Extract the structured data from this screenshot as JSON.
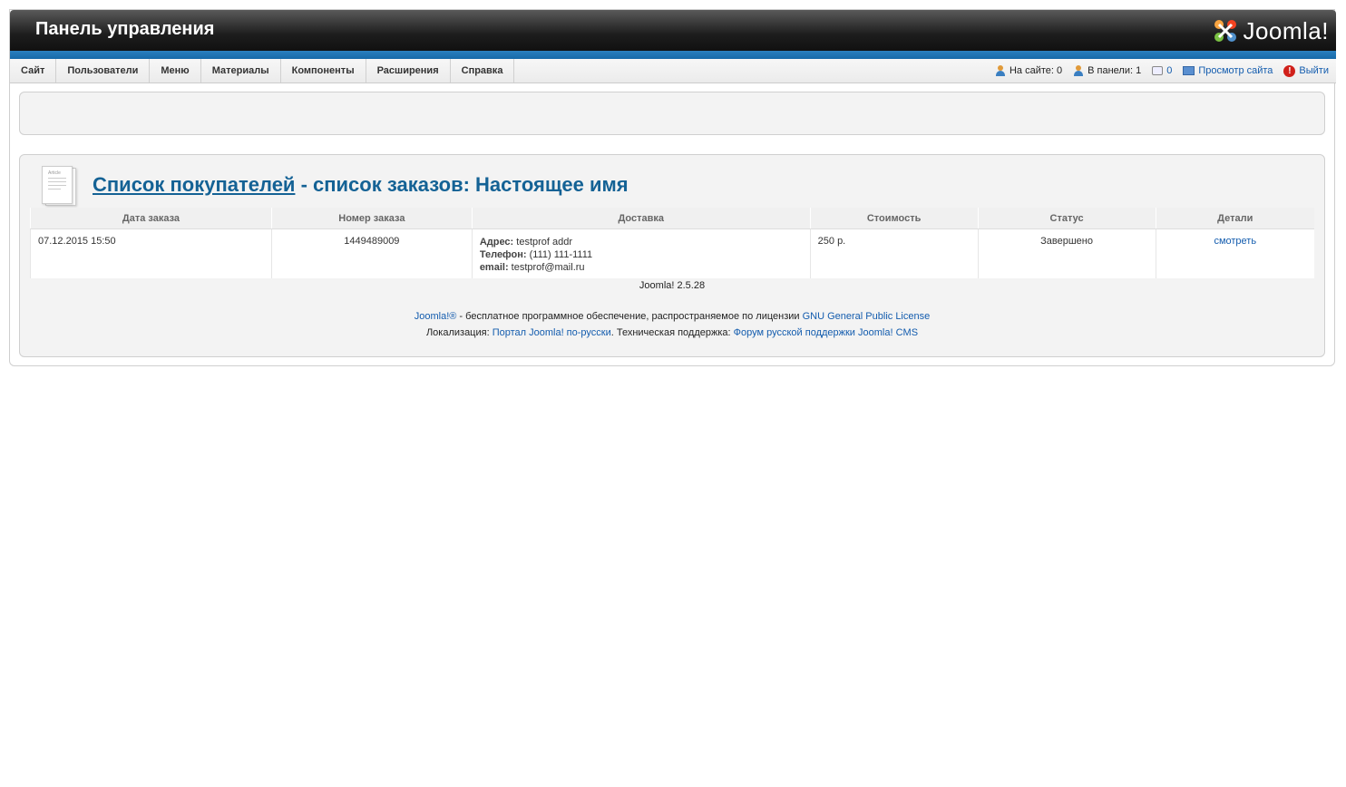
{
  "header": {
    "title": "Панель управления",
    "logo_text": "Joomla!",
    "logo_registered": "®"
  },
  "menu": {
    "items": [
      {
        "label": "Сайт"
      },
      {
        "label": "Пользователи"
      },
      {
        "label": "Меню"
      },
      {
        "label": "Материалы"
      },
      {
        "label": "Компоненты"
      },
      {
        "label": "Расширения"
      },
      {
        "label": "Справка"
      }
    ]
  },
  "status": {
    "on_site": "На сайте: 0",
    "in_panel": "В панели: 1",
    "messages": "0",
    "view_site": "Просмотр сайта",
    "logout": "Выйти"
  },
  "page": {
    "icon_label": "Article",
    "title_link": "Список покупателей",
    "title_rest": " - список заказов: Настоящее имя"
  },
  "orders": {
    "columns": [
      "Дата заказа",
      "Номер заказа",
      "Доставка",
      "Стоимость",
      "Статус",
      "Детали"
    ],
    "rows": [
      {
        "date": "07.12.2015 15:50",
        "number": "1449489009",
        "address_label": "Адрес:",
        "address": "testprof addr",
        "phone_label": "Телефон:",
        "phone": "(111) 111-1111",
        "email_label": "email:",
        "email": "testprof@mail.ru",
        "cost": "250 р.",
        "status": "Завершено",
        "details": "смотреть"
      }
    ]
  },
  "footer": {
    "version": "Joomla! 2.5.28",
    "joomla_link": "Joomla!®",
    "license_text": " - бесплатное программное обеспечение, распространяемое по лицензии ",
    "license_link": "GNU General Public License",
    "localization_label": "Локализация: ",
    "portal_link": "Портал Joomla! по-русски",
    "support_label": ". Техническая поддержка: ",
    "forum_link": "Форум русской поддержки Joomla! CMS"
  },
  "colors": {
    "accent_blue": "#146295",
    "link": "#135cae",
    "bar_blue": "#1669a8"
  }
}
